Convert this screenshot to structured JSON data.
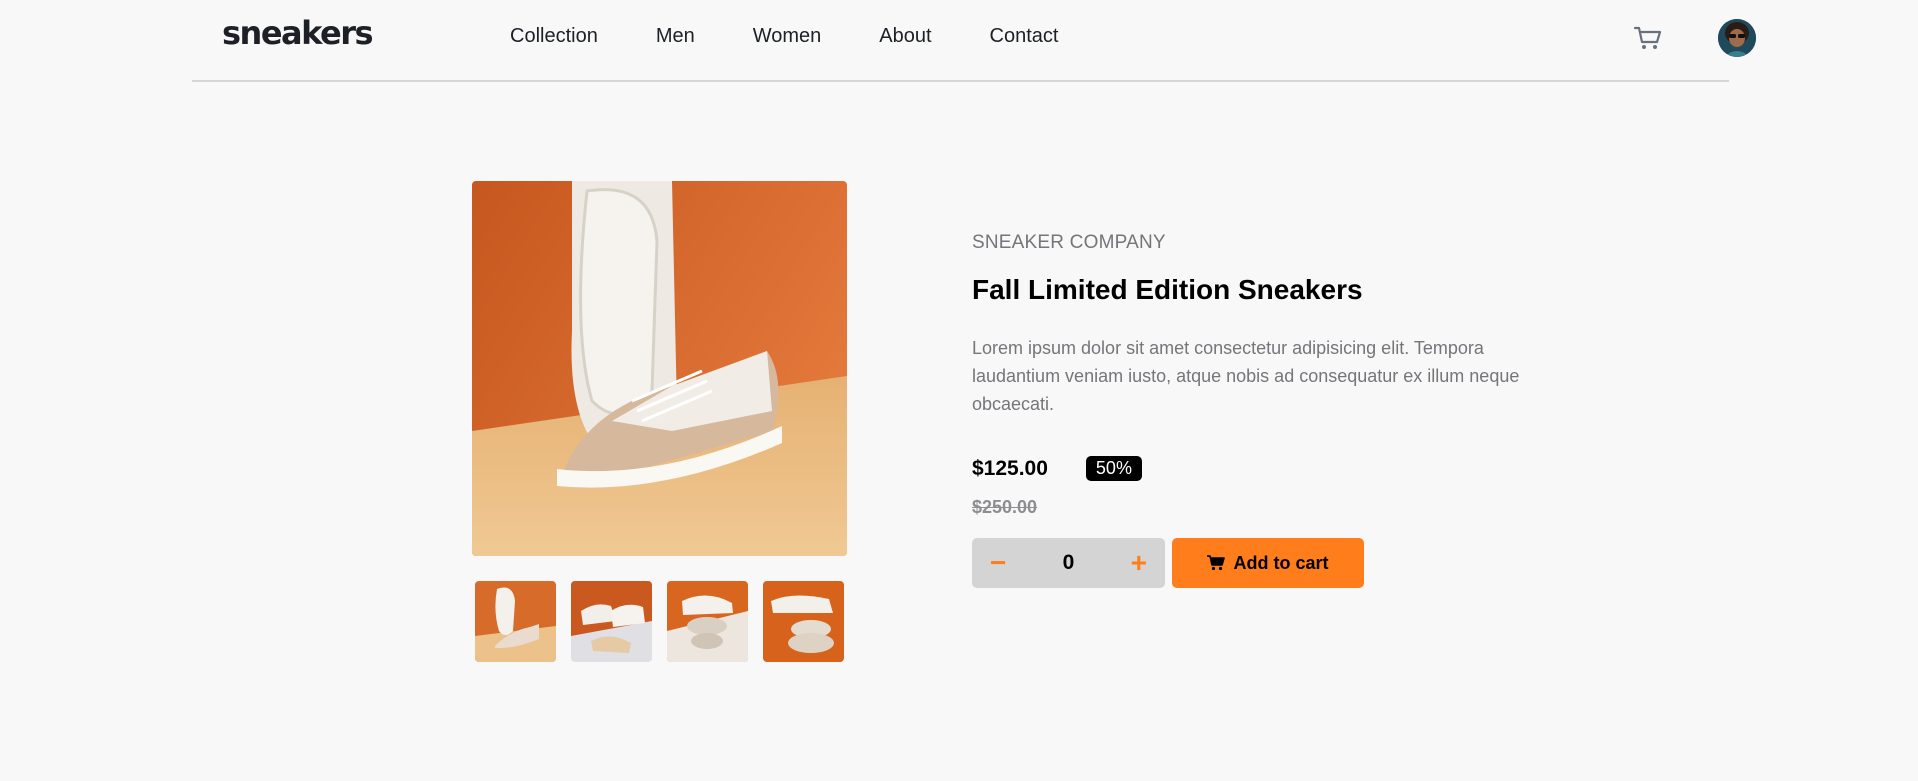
{
  "header": {
    "logo": "sneakers",
    "nav": [
      "Collection",
      "Men",
      "Women",
      "About",
      "Contact"
    ],
    "cart_icon": "cart-icon",
    "avatar_icon": "avatar"
  },
  "product": {
    "company": "SNEAKER COMPANY",
    "title": "Fall Limited Edition Sneakers",
    "description": "Lorem ipsum dolor sit amet consectetur adipisicing elit. Tempora laudantium veniam iusto, atque nobis ad consequatur ex illum neque obcaecati.",
    "price": "$125.00",
    "discount": "50%",
    "old_price": "$250.00",
    "quantity": "0",
    "minus_label": "−",
    "plus_label": "+",
    "add_to_cart": "Add to cart"
  },
  "colors": {
    "accent": "#ff7e1b",
    "text_dark": "#1d2026",
    "text_muted": "#75757a"
  }
}
